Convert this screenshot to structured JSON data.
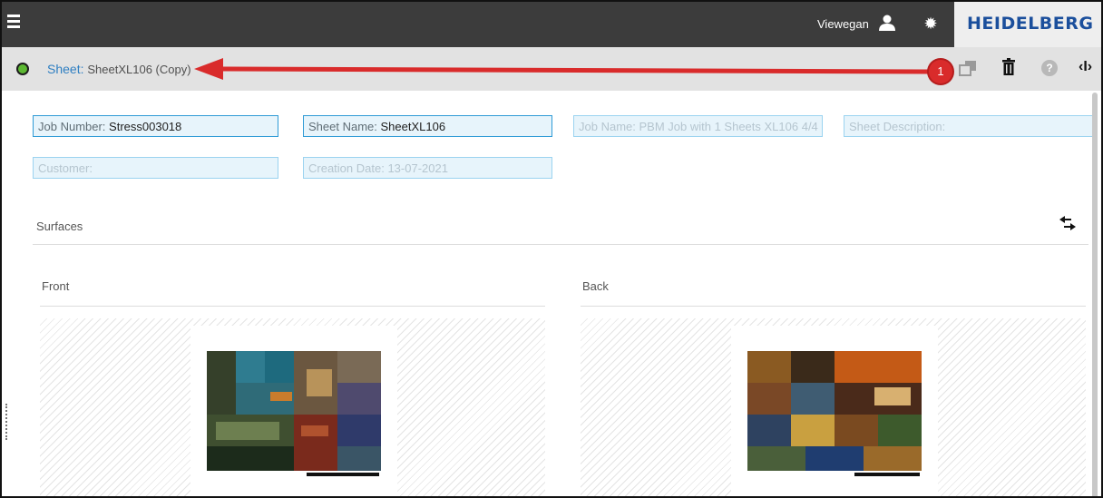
{
  "topbar": {
    "user_name": "Viewegan",
    "brand": "HEIDELBERG",
    "icons": [
      "hamburger-menu-icon",
      "user-icon",
      "gear-icon"
    ]
  },
  "subheader": {
    "sheet_key": "Sheet:",
    "sheet_value": "SheetXL106 (Copy)",
    "status_color": "#5cb832",
    "icons": [
      "copy-icon",
      "trash-icon",
      "help-icon",
      "toggle-panel-icon"
    ]
  },
  "annotation": {
    "badge": "1",
    "color": "#d92b2b"
  },
  "fields": {
    "job_number": {
      "label": "Job Number:",
      "value": "Stress003018"
    },
    "sheet_name": {
      "label": "Sheet Name:",
      "value": "SheetXL106"
    },
    "job_name": {
      "label": "Job Name:",
      "value": "PBM Job with 1 Sheets XL106 4/4"
    },
    "sheet_description": {
      "label": "Sheet Description:",
      "value": ""
    },
    "customer": {
      "label": "Customer:",
      "value": ""
    },
    "creation_date": {
      "label": "Creation Date:",
      "value": "13-07-2021"
    }
  },
  "surfaces": {
    "title": "Surfaces",
    "front_title": "Front",
    "back_title": "Back"
  },
  "colors": {
    "topbar_bg": "#3c3c3c",
    "subheader_bg": "#e2e2e2",
    "field_border": "#9bd3f0",
    "field_bg": "#e7f4fb",
    "brand_blue": "#1b4f9c"
  }
}
